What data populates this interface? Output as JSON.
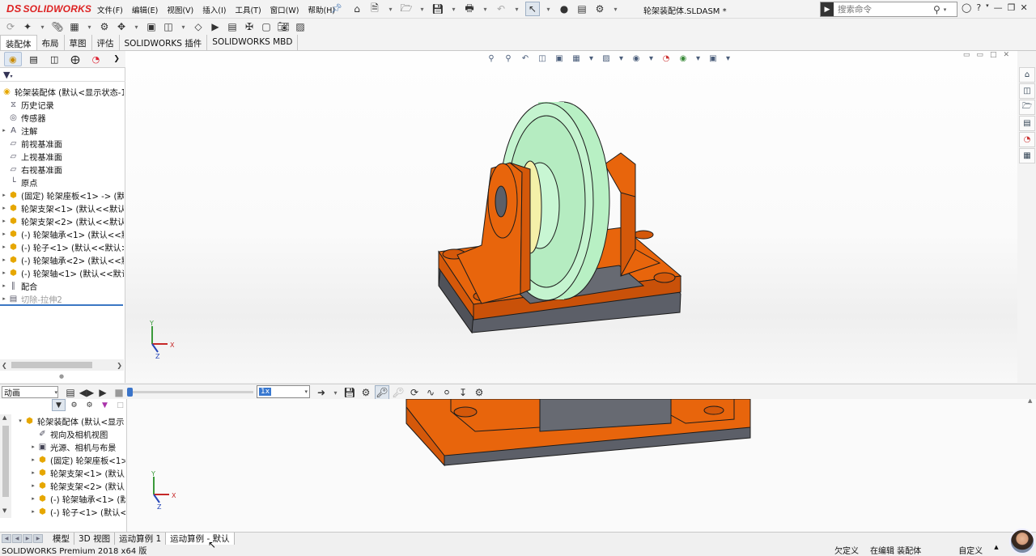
{
  "app": {
    "logo_text": "SOLIDWORKS",
    "logo_mark": "DS",
    "document_title": "轮架装配体.SLDASM *"
  },
  "menu": [
    "文件(F)",
    "编辑(E)",
    "视图(V)",
    "插入(I)",
    "工具(T)",
    "窗口(W)",
    "帮助(H)"
  ],
  "search": {
    "placeholder": "搜索命令"
  },
  "command_tabs": [
    {
      "label": "装配体",
      "active": true
    },
    {
      "label": "布局",
      "active": false
    },
    {
      "label": "草图",
      "active": false
    },
    {
      "label": "评估",
      "active": false
    },
    {
      "label": "SOLIDWORKS 插件",
      "active": false
    },
    {
      "label": "SOLIDWORKS MBD",
      "active": false
    }
  ],
  "feature_tree": {
    "root": "轮架装配体 (默认<显示状态-1",
    "items": [
      {
        "label": "历史记录",
        "icon": "history-icon",
        "expand": false,
        "dim": false
      },
      {
        "label": "传感器",
        "icon": "sensor-icon",
        "expand": false,
        "dim": false
      },
      {
        "label": "注解",
        "icon": "annotation-icon",
        "expand": true,
        "dim": false
      },
      {
        "label": "前视基准面",
        "icon": "plane-icon",
        "expand": false,
        "dim": false
      },
      {
        "label": "上视基准面",
        "icon": "plane-icon",
        "expand": false,
        "dim": false
      },
      {
        "label": "右视基准面",
        "icon": "plane-icon",
        "expand": false,
        "dim": false
      },
      {
        "label": "原点",
        "icon": "origin-icon",
        "expand": false,
        "dim": false
      },
      {
        "label": "(固定) 轮架座板<1> -> (默",
        "icon": "part-icon",
        "expand": true,
        "dim": false
      },
      {
        "label": "轮架支架<1> (默认<<默认",
        "icon": "part-icon",
        "expand": true,
        "dim": false
      },
      {
        "label": "轮架支架<2> (默认<<默认",
        "icon": "part-icon",
        "expand": true,
        "dim": false
      },
      {
        "label": "(-) 轮架轴承<1> (默认<<默",
        "icon": "part-icon",
        "expand": true,
        "dim": false
      },
      {
        "label": "(-) 轮子<1> (默认<<默认>",
        "icon": "part-icon",
        "expand": true,
        "dim": false
      },
      {
        "label": "(-) 轮架轴承<2> (默认<<默",
        "icon": "part-icon",
        "expand": true,
        "dim": false
      },
      {
        "label": "(-) 轮架轴<1> (默认<<默认",
        "icon": "part-icon",
        "expand": true,
        "dim": false
      },
      {
        "label": "配合",
        "icon": "mate-icon",
        "expand": true,
        "dim": false
      },
      {
        "label": "切除-拉伸2",
        "icon": "cut-extrude-icon",
        "expand": true,
        "dim": true
      }
    ]
  },
  "motion": {
    "study_type": "动画",
    "speed": "1x",
    "tree": [
      {
        "label": "轮架装配体 (默认<显示",
        "expand": true,
        "indent": 0
      },
      {
        "label": "视向及相机视图",
        "expand": false,
        "indent": 1
      },
      {
        "label": "光源、相机与布景",
        "expand": true,
        "indent": 1
      },
      {
        "label": "(固定) 轮架座板<1>",
        "expand": true,
        "indent": 1
      },
      {
        "label": "轮架支架<1> (默认<",
        "expand": true,
        "indent": 1
      },
      {
        "label": "轮架支架<2> (默认<",
        "expand": true,
        "indent": 1
      },
      {
        "label": "(-) 轮架轴承<1> (默",
        "expand": true,
        "indent": 1
      },
      {
        "label": "(-) 轮子<1> (默认<<",
        "expand": true,
        "indent": 1
      }
    ]
  },
  "bottom_tabs": [
    {
      "label": "模型",
      "active": false
    },
    {
      "label": "3D 视图",
      "active": false
    },
    {
      "label": "运动算例 1",
      "active": false
    },
    {
      "label": "运动算例 - 默认",
      "active": true
    }
  ],
  "status": {
    "product": "SOLIDWORKS Premium 2018 x64 版",
    "definition": "欠定义",
    "editing": "在编辑 装配体",
    "units": "自定义"
  },
  "colors": {
    "bracket": "#e8650c",
    "base": "#5c5f68",
    "wheel": "#b8f0c4",
    "bearing": "#f4f0a8",
    "accent": "#3a74c9"
  }
}
